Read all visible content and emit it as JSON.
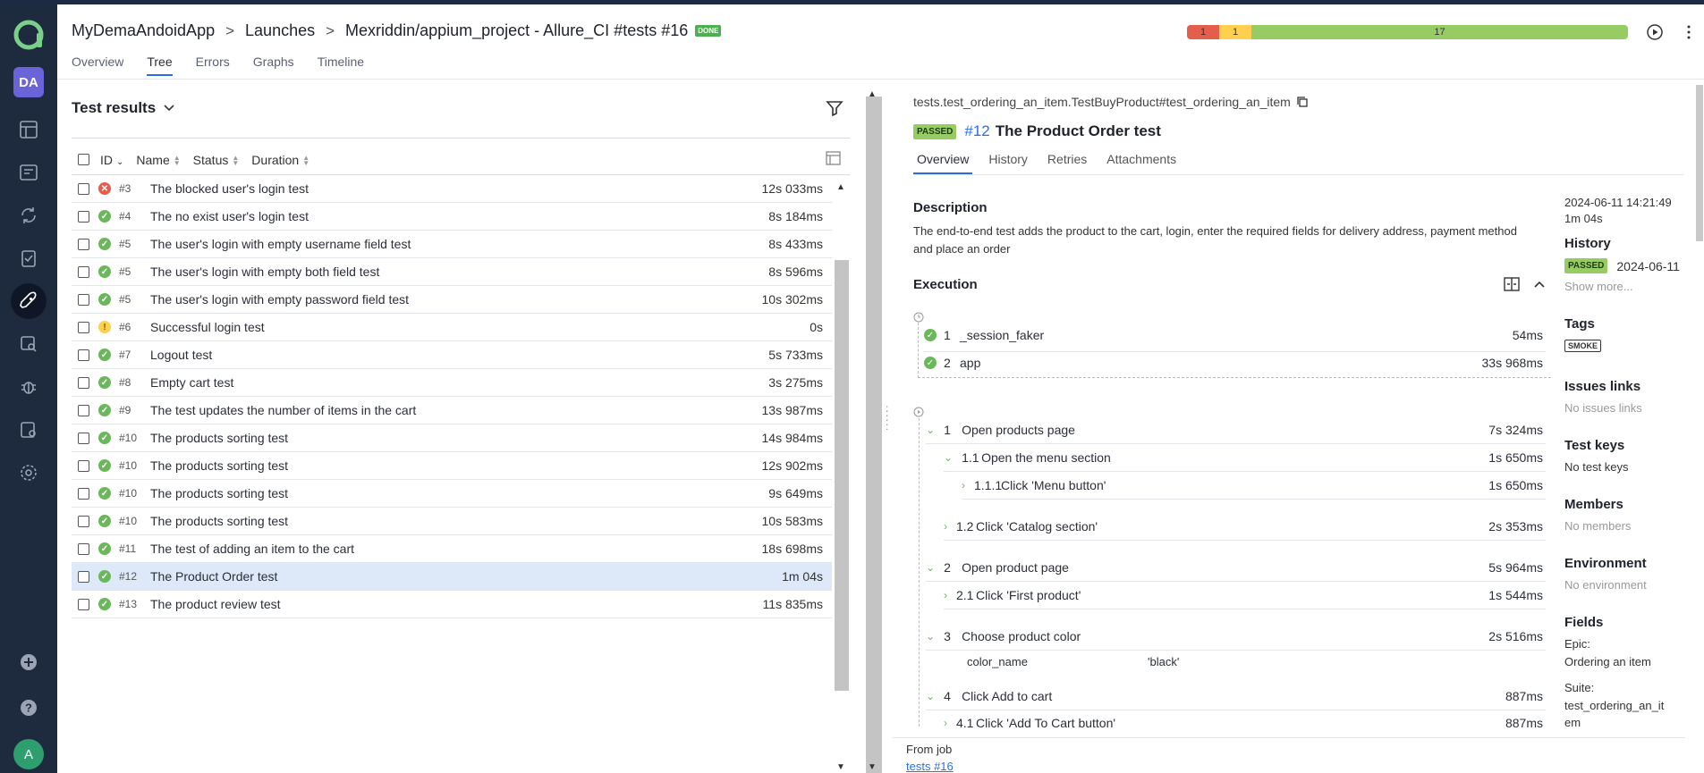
{
  "header": {
    "breadcrumb": [
      "MyDemaAndoidApp",
      "Launches",
      "Mexriddin/appium_project - Allure_CI #tests #16"
    ],
    "status_badge": "DONE",
    "stats": {
      "failed": "1",
      "broken": "1",
      "passed": "17"
    },
    "tabs": [
      "Overview",
      "Tree",
      "Errors",
      "Graphs",
      "Timeline"
    ],
    "active_tab": "Tree"
  },
  "sidebar": {
    "workspace_avatar": "DA",
    "user_avatar": "A"
  },
  "colors": {
    "passed": "#97cc64",
    "failed": "#e35e4b",
    "broken": "#ffd050",
    "accent": "#2a6ee7",
    "sidebar": "#1e2a3e"
  },
  "left": {
    "title": "Test results",
    "columns": {
      "id": "ID",
      "name": "Name",
      "status": "Status",
      "duration": "Duration"
    },
    "rows": [
      {
        "status": "failed",
        "id": "#3",
        "name": "The blocked user's login test",
        "duration": "12s 033ms"
      },
      {
        "status": "passed",
        "id": "#4",
        "name": "The no exist user's login test",
        "duration": "8s 184ms"
      },
      {
        "status": "passed",
        "id": "#5",
        "name": "The user's login with empty username field test",
        "duration": "8s 433ms"
      },
      {
        "status": "passed",
        "id": "#5",
        "name": "The user's login with empty both field test",
        "duration": "8s 596ms"
      },
      {
        "status": "passed",
        "id": "#5",
        "name": "The user's login with empty password field test",
        "duration": "10s 302ms"
      },
      {
        "status": "broken",
        "id": "#6",
        "name": "Successful login test",
        "duration": "0s"
      },
      {
        "status": "passed",
        "id": "#7",
        "name": "Logout test",
        "duration": "5s 733ms"
      },
      {
        "status": "passed",
        "id": "#8",
        "name": "Empty cart test",
        "duration": "3s 275ms"
      },
      {
        "status": "passed",
        "id": "#9",
        "name": "The test updates the number of items in the cart",
        "duration": "13s 987ms"
      },
      {
        "status": "passed",
        "id": "#10",
        "name": "The products sorting test",
        "duration": "14s 984ms"
      },
      {
        "status": "passed",
        "id": "#10",
        "name": "The products sorting test",
        "duration": "12s 902ms"
      },
      {
        "status": "passed",
        "id": "#10",
        "name": "The products sorting test",
        "duration": "9s 649ms"
      },
      {
        "status": "passed",
        "id": "#10",
        "name": "The products sorting test",
        "duration": "10s 583ms"
      },
      {
        "status": "passed",
        "id": "#11",
        "name": "The test of adding an item to the cart",
        "duration": "18s 698ms"
      },
      {
        "status": "passed",
        "id": "#12",
        "name": "The Product Order test",
        "duration": "1m 04s",
        "selected": true
      },
      {
        "status": "passed",
        "id": "#13",
        "name": "The product review test",
        "duration": "11s 835ms"
      }
    ]
  },
  "detail": {
    "path": "tests.test_ordering_an_item.TestBuyProduct#test_ordering_an_item",
    "status_badge": "PASSED",
    "number": "#12",
    "title": "The Product Order test",
    "tabs": [
      "Overview",
      "History",
      "Retries",
      "Attachments"
    ],
    "description_heading": "Description",
    "description": "The end-to-end test adds the product to the cart, login, enter the required fields for delivery address, payment method and place an order",
    "execution_heading": "Execution",
    "setup": [
      {
        "num": "1",
        "name": "_session_faker",
        "duration": "54ms"
      },
      {
        "num": "2",
        "name": "app",
        "duration": "33s 968ms"
      }
    ],
    "steps": [
      {
        "num": "1",
        "name": "Open products page",
        "duration": "7s 324ms"
      },
      {
        "num": "1.1",
        "name": "Open the menu section",
        "duration": "1s 650ms"
      },
      {
        "num": "1.1.1",
        "name": "Click 'Menu button'",
        "duration": "1s 650ms"
      },
      {
        "num": "1.2",
        "name": "Click 'Catalog section'",
        "duration": "2s 353ms"
      },
      {
        "num": "2",
        "name": "Open product page",
        "duration": "5s 964ms"
      },
      {
        "num": "2.1",
        "name": "Click 'First product'",
        "duration": "1s 544ms"
      },
      {
        "num": "3",
        "name": "Choose product color",
        "duration": "2s 516ms"
      },
      {
        "num": "4",
        "name": "Click Add to cart",
        "duration": "887ms"
      },
      {
        "num": "4.1",
        "name": "Click 'Add To Cart button'",
        "duration": "887ms"
      }
    ],
    "param": {
      "name": "color_name",
      "value": "'black'"
    },
    "from_job_label": "From job",
    "from_job_link": "tests #16"
  },
  "meta": {
    "date": "2024-06-11 14:21:49",
    "duration": "1m 04s",
    "history_heading": "History",
    "history_badge": "PASSED",
    "history_date": "2024-06-11",
    "show_more": "Show more...",
    "tags_heading": "Tags",
    "tag": "SMOKE",
    "issues_heading": "Issues links",
    "issues_value": "No issues links",
    "test_keys_heading": "Test keys",
    "test_keys_value": "No test keys",
    "members_heading": "Members",
    "members_value": "No members",
    "env_heading": "Environment",
    "env_value": "No environment",
    "fields_heading": "Fields",
    "epic_label": "Epic:",
    "epic_value": "Ordering an item",
    "suite_label": "Suite:",
    "suite_value": "test_ordering_an_it",
    "suite_value_2": "em"
  }
}
